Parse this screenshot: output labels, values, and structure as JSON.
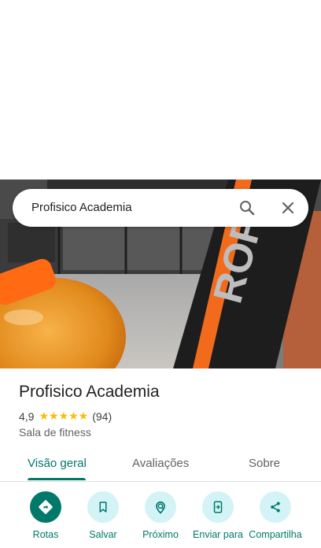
{
  "search": {
    "query": "Profisico Academia"
  },
  "place": {
    "name": "Profisico Academia",
    "rating": "4,9",
    "stars": "★★★★★",
    "review_count": "(94)",
    "category": "Sala de fitness"
  },
  "tabs": [
    {
      "label": "Visão geral",
      "active": true
    },
    {
      "label": "Avaliações",
      "active": false
    },
    {
      "label": "Sobre",
      "active": false
    }
  ],
  "actions": [
    {
      "label": "Rotas",
      "icon": "directions-icon"
    },
    {
      "label": "Salvar",
      "icon": "bookmark-icon"
    },
    {
      "label": "Próximo",
      "icon": "nearby-icon"
    },
    {
      "label": "Enviar para",
      "icon": "send-to-phone-icon"
    },
    {
      "label": "Compartilha",
      "icon": "share-icon"
    }
  ],
  "colors": {
    "accent": "#00796b",
    "action_bg": "#d4f3f7",
    "star": "#fbbc04",
    "sign_orange": "#f26b1d"
  }
}
